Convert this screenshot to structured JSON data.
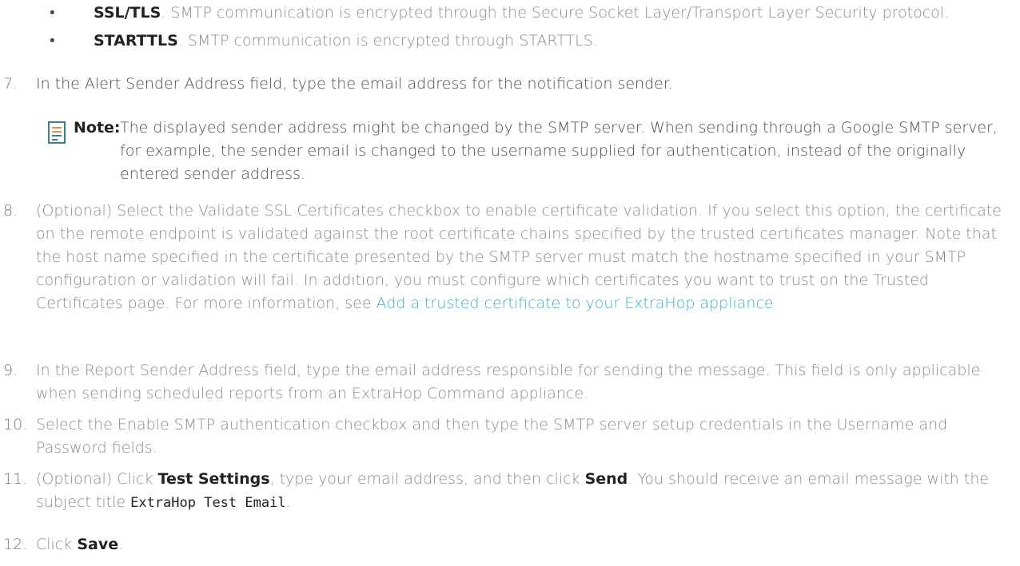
{
  "bullets": [
    {
      "marker": "•",
      "term": "SSL/TLS",
      "text": ". SMTP communication is encrypted through the Secure Socket Layer/Transport Layer Security protocol."
    },
    {
      "marker": "•",
      "term": "STARTTLS",
      "text": ". SMTP communication is encrypted through STARTTLS."
    }
  ],
  "steps": {
    "s7": {
      "num": "7.",
      "text": "In the Alert Sender Address field, type the email address for the notification sender."
    },
    "note": {
      "label": "Note:",
      "text": "The displayed sender address might be changed by the SMTP server. When sending through a Google SMTP server, for example, the sender email is changed to the username supplied for authentication, instead of the originally entered sender address."
    },
    "s8": {
      "num": "8.",
      "text": "(Optional) Select the Validate SSL Certificates checkbox to enable certificate validation. If you select this option, the certificate on the remote endpoint is validated against the root certificate chains specified by the trusted certificates manager. Note that the host name specified in the certificate presented by the SMTP server must match the hostname specified in your SMTP configuration or validation will fail. In addition, you must configure which certificates you want to trust on the Trusted Certificates page. For more information, see ",
      "link": "Add a trusted certificate to your ExtraHop appliance"
    },
    "s9": {
      "num": "9.",
      "text": "In the Report Sender Address field, type the email address responsible for sending the message. This field is only applicable when sending scheduled reports from an ExtraHop Command appliance."
    },
    "s10": {
      "num": "10.",
      "text": "Select the Enable SMTP authentication checkbox and then type the SMTP server setup credentials in the Username and Password fields."
    },
    "s11": {
      "num": "11.",
      "pre": "(Optional) Click ",
      "b1": "Test Settings",
      "mid": ", type your email address, and then click ",
      "b2": "Send",
      "post": ". You should receive an email message with the subject title ",
      "code": "ExtraHop Test Email",
      "end": "."
    },
    "s12": {
      "num": "12.",
      "pre": "Click ",
      "b": "Save",
      "end": "."
    }
  },
  "colors": {
    "link": "#3ab0c6",
    "text": "#4a4a4a",
    "note_icon_lines": "#f08a4b",
    "note_icon_frame": "#3a7c8c"
  }
}
